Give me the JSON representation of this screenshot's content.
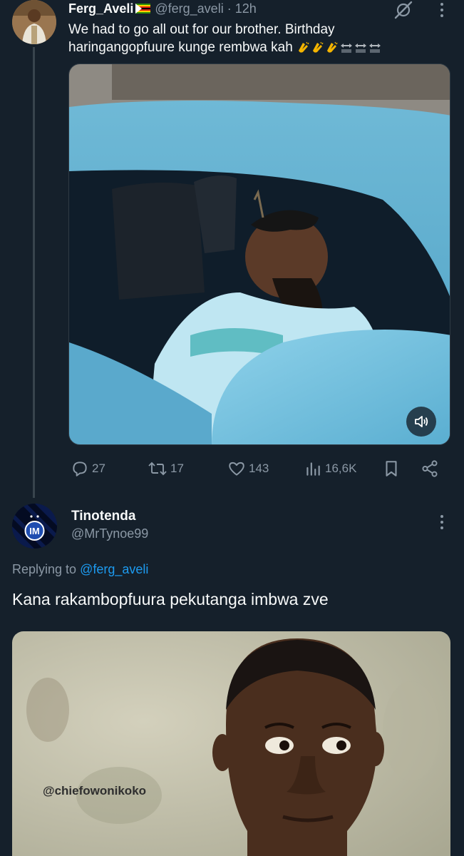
{
  "tweet": {
    "author_name": "Ferg_Aveli",
    "handle": "@ferg_aveli",
    "time": "12h",
    "text": "We had to go all out for our brother. Birthday haringangopfuure kunge rembwa kah",
    "flag_icon": "zimbabwe-flag-icon",
    "emojis": [
      "clapping-hands-icon",
      "clapping-hands-icon",
      "clapping-hands-icon",
      "on-arrow-icon",
      "on-arrow-icon",
      "on-arrow-icon"
    ],
    "stats": {
      "replies": "27",
      "reposts": "17",
      "likes": "143",
      "views": "16,6K"
    }
  },
  "reply": {
    "author_name": "Tinotenda",
    "handle": "@MrTynoe99",
    "replying_prefix": "Replying to ",
    "replying_to": "@ferg_aveli",
    "text": "Kana rakambopfuura pekutanga imbwa zve",
    "media_watermark": "@chiefowonikoko"
  },
  "colors": {
    "background": "#15202b",
    "primary_text": "#f7f9f9",
    "secondary_text": "#8b98a5",
    "link": "#1d9bf0",
    "thread_line": "#38444d"
  }
}
